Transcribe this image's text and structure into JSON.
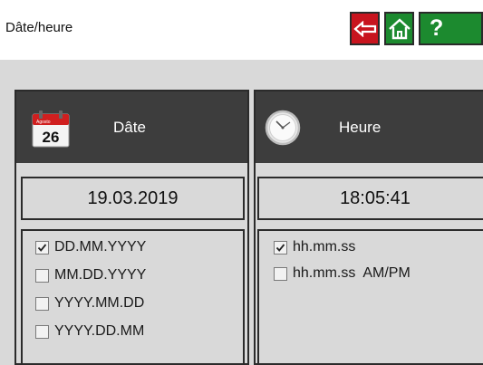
{
  "header": {
    "title": "Dâte/heure",
    "back_icon": "arrow-left-icon",
    "home_icon": "home-icon",
    "help_label": "?"
  },
  "colors": {
    "back": "#c8141e",
    "nav": "#1c8a2f",
    "panel_header": "#3d3d3d",
    "background": "#d9d9d9"
  },
  "date_panel": {
    "icon": "calendar-icon",
    "calendar_month": "Agosto",
    "calendar_day": "26",
    "label": "Dâte",
    "value": "19.03.2019",
    "options": [
      {
        "label": "DD.MM.YYYY",
        "checked": true
      },
      {
        "label": "MM.DD.YYYY",
        "checked": false
      },
      {
        "label": "YYYY.MM.DD",
        "checked": false
      },
      {
        "label": "YYYY.DD.MM",
        "checked": false
      }
    ]
  },
  "time_panel": {
    "icon": "clock-icon",
    "label": "Heure",
    "value": "18:05:41",
    "options": [
      {
        "label": "hh.mm.ss",
        "checked": true
      },
      {
        "label": "hh.mm.ss  AM/PM",
        "checked": false
      }
    ]
  }
}
